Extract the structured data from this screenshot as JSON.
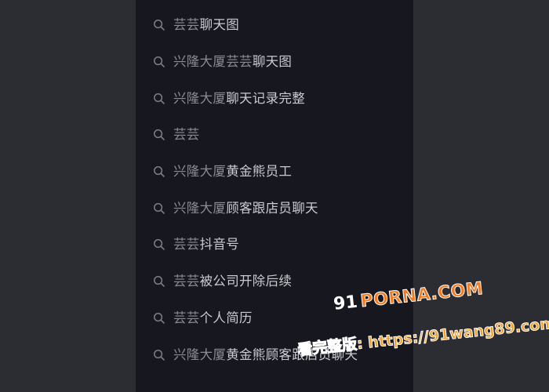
{
  "colors": {
    "page_background": "#2c2d33",
    "panel_background": "#17181f",
    "prefix_text": "#8b8c93",
    "highlight_text": "#c9cad0",
    "icon": "#7d7e86",
    "watermark_orange": "#f47a1f"
  },
  "suggestions": {
    "icon": "search-icon",
    "items": [
      {
        "prefix": "芸芸",
        "rest": "聊天图"
      },
      {
        "prefix": "兴隆大厦芸芸",
        "rest": "聊天图"
      },
      {
        "prefix": "兴隆大厦",
        "rest": "聊天记录完整"
      },
      {
        "prefix": "芸芸",
        "rest": ""
      },
      {
        "prefix": "兴隆大厦",
        "rest": "黄金熊员工"
      },
      {
        "prefix": "兴隆大厦",
        "rest": "顾客跟店员聊天"
      },
      {
        "prefix": "芸芸",
        "rest": "抖音号"
      },
      {
        "prefix": "芸芸",
        "rest": "被公司开除后续"
      },
      {
        "prefix": "芸芸",
        "rest": "个人简历"
      },
      {
        "prefix": "兴隆大厦",
        "rest": "黄金熊顾客跟店员聊天"
      }
    ]
  },
  "watermark": {
    "logo_number": "91",
    "logo_text": "PORNA.COM",
    "url_text": "看完整版: https://91wang89.com"
  }
}
